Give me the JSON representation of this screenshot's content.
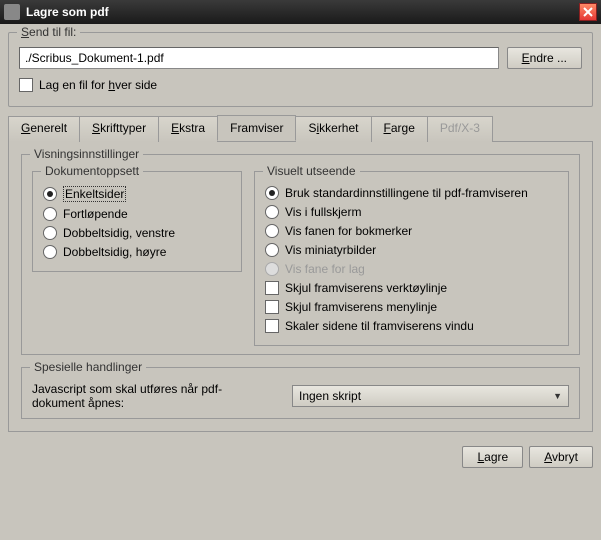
{
  "title": "Lagre som pdf",
  "sendToFile": {
    "legend": "Send til fil:",
    "value": "./Scribus_Dokument-1.pdf",
    "changeBtn": "Endre ...",
    "perPageCheckbox": "Lag en fil for hver side"
  },
  "tabs": {
    "general": "Generelt",
    "fonts": "Skrifttyper",
    "extra": "Ekstra",
    "viewer": "Framviser",
    "security": "Sikkerhet",
    "color": "Farge",
    "pdfx3": "Pdf/X-3"
  },
  "viewSettings": {
    "legend": "Visningsinnstillinger",
    "layout": {
      "legend": "Dokumentoppsett",
      "single": "Enkeltsider",
      "continuous": "Fortløpende",
      "doubleLeft": "Dobbeltsidig, venstre",
      "doubleRight": "Dobbeltsidig, høyre"
    },
    "visual": {
      "legend": "Visuelt utseende",
      "default": "Bruk standardinnstillingene til pdf-framviseren",
      "fullscreen": "Vis i fullskjerm",
      "bookmarks": "Vis fanen for bokmerker",
      "thumbnails": "Vis miniatyrbilder",
      "layers": "Vis fane for lag",
      "hideToolbar": "Skjul framviserens verktøylinje",
      "hideMenubar": "Skjul framviserens menylinje",
      "fitWindow": "Skaler sidene til framviserens vindu"
    }
  },
  "special": {
    "legend": "Spesielle handlinger",
    "jsLabel": "Javascript som skal utføres når pdf-dokument åpnes:",
    "selectValue": "Ingen skript"
  },
  "buttons": {
    "save": "Lagre",
    "cancel": "Avbryt"
  }
}
